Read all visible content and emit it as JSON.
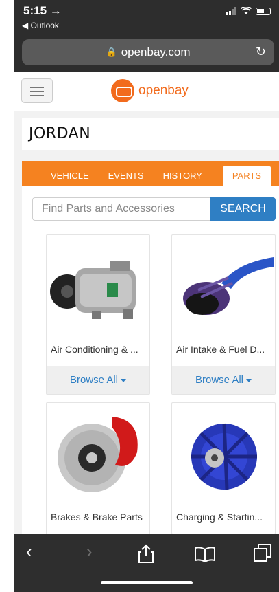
{
  "status": {
    "time": "5:15 →",
    "back_app": "◀ Outlook"
  },
  "browser": {
    "url": "openbay.com",
    "lock_icon": "🔒",
    "reload_icon": "↻"
  },
  "site": {
    "logo_text": "openbay",
    "brand_color": "#f26b1d"
  },
  "page": {
    "title": "JORDAN"
  },
  "tabs": [
    {
      "label": "VEHICLE"
    },
    {
      "label": "EVENTS"
    },
    {
      "label": "HISTORY"
    },
    {
      "label": "PARTS"
    }
  ],
  "search": {
    "placeholder": "Find Parts and Accessories",
    "button_label": "SEARCH"
  },
  "categories": [
    {
      "name": "Air Conditioning & ...",
      "action": "Browse All",
      "image": "ac-compressor"
    },
    {
      "name": "Air Intake & Fuel D...",
      "action": "Browse All",
      "image": "air-intake-filter"
    },
    {
      "name": "Brakes & Brake Parts",
      "action": "",
      "image": "brake-disc-caliper"
    },
    {
      "name": "Charging & Startin...",
      "action": "",
      "image": "alternator"
    }
  ],
  "toolbar": {
    "back": "‹",
    "forward": "›",
    "share": "↑",
    "bookmarks": "📖",
    "tabs": "⧉"
  }
}
